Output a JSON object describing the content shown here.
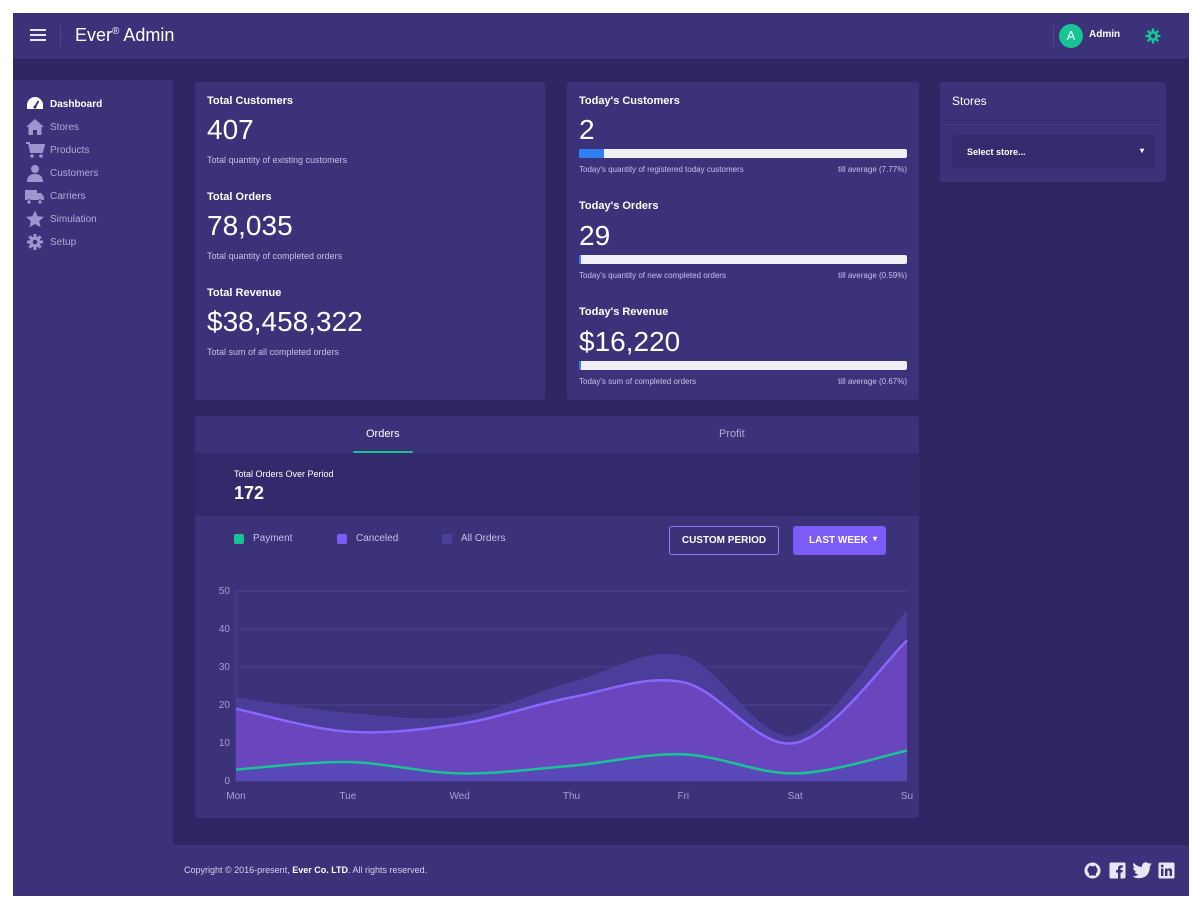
{
  "header": {
    "brand": "Ever",
    "brand_mark": "®",
    "brand_suffix": " Admin",
    "avatar_letter": "A",
    "user_name": "Admin"
  },
  "sidebar": {
    "items": [
      {
        "label": "Dashboard",
        "icon": "dashboard-icon",
        "active": true
      },
      {
        "label": "Stores",
        "icon": "home-icon"
      },
      {
        "label": "Products",
        "icon": "cart-icon"
      },
      {
        "label": "Customers",
        "icon": "user-icon"
      },
      {
        "label": "Carriers",
        "icon": "truck-icon"
      },
      {
        "label": "Simulation",
        "icon": "star-icon"
      },
      {
        "label": "Setup",
        "icon": "gear-icon"
      }
    ]
  },
  "totals": {
    "customers": {
      "title": "Total Customers",
      "value": "407",
      "sub": "Total quantity of existing customers"
    },
    "orders": {
      "title": "Total Orders",
      "value": "78,035",
      "sub": "Total quantity of completed orders"
    },
    "revenue": {
      "title": "Total Revenue",
      "value": "$38,458,322",
      "sub": "Total sum of all completed orders"
    }
  },
  "today": {
    "customers": {
      "title": "Today's Customers",
      "value": "2",
      "sub": "Today's quantity of registered today customers",
      "avg": "till average (7.77%)",
      "progress": 7.77
    },
    "orders": {
      "title": "Today's Orders",
      "value": "29",
      "sub": "Today's quantity of new completed orders",
      "avg": "till average (0.59%)",
      "progress": 0.59
    },
    "revenue": {
      "title": "Today's Revenue",
      "value": "$16,220",
      "sub": "Today's sum of completed orders",
      "avg": "till average (0.67%)",
      "progress": 0.67
    }
  },
  "stores": {
    "title": "Stores",
    "select_value": "Select store...",
    "select_arrow": "▾"
  },
  "chart_panel": {
    "tabs": [
      "Orders",
      "Profit"
    ],
    "active_tab": "Orders",
    "period_label": "Total Orders Over Period",
    "period_value": "172",
    "custom_period_label": "CUSTOM PERIOD",
    "last_week_label": "LAST WEEK",
    "last_week_caret": "▾"
  },
  "colors": {
    "payment": "#19c394",
    "canceled": "#7b5cf6",
    "all_orders": "#4b3f9c",
    "accent": "#19c394",
    "progress": "#2f7ff2"
  },
  "chart_data": {
    "type": "area",
    "categories": [
      "Mon",
      "Tue",
      "Wed",
      "Thu",
      "Fri",
      "Sat",
      "Su"
    ],
    "ylim": [
      0,
      50
    ],
    "yticks": [
      0,
      10,
      20,
      30,
      40,
      50
    ],
    "legend_position": "top-left",
    "grid": true,
    "series": [
      {
        "name": "Payment",
        "values": [
          3,
          5,
          2,
          4,
          7,
          2,
          8
        ]
      },
      {
        "name": "Canceled",
        "values": [
          19,
          13,
          15,
          22,
          26,
          10,
          37
        ]
      },
      {
        "name": "All Orders",
        "values": [
          22,
          18,
          17,
          26,
          33,
          12,
          45
        ]
      }
    ]
  },
  "footer": {
    "copy_prefix": "Copyright © 2016-present, ",
    "company": "Ever Co. LTD",
    "copy_suffix": ". All rights reserved."
  }
}
